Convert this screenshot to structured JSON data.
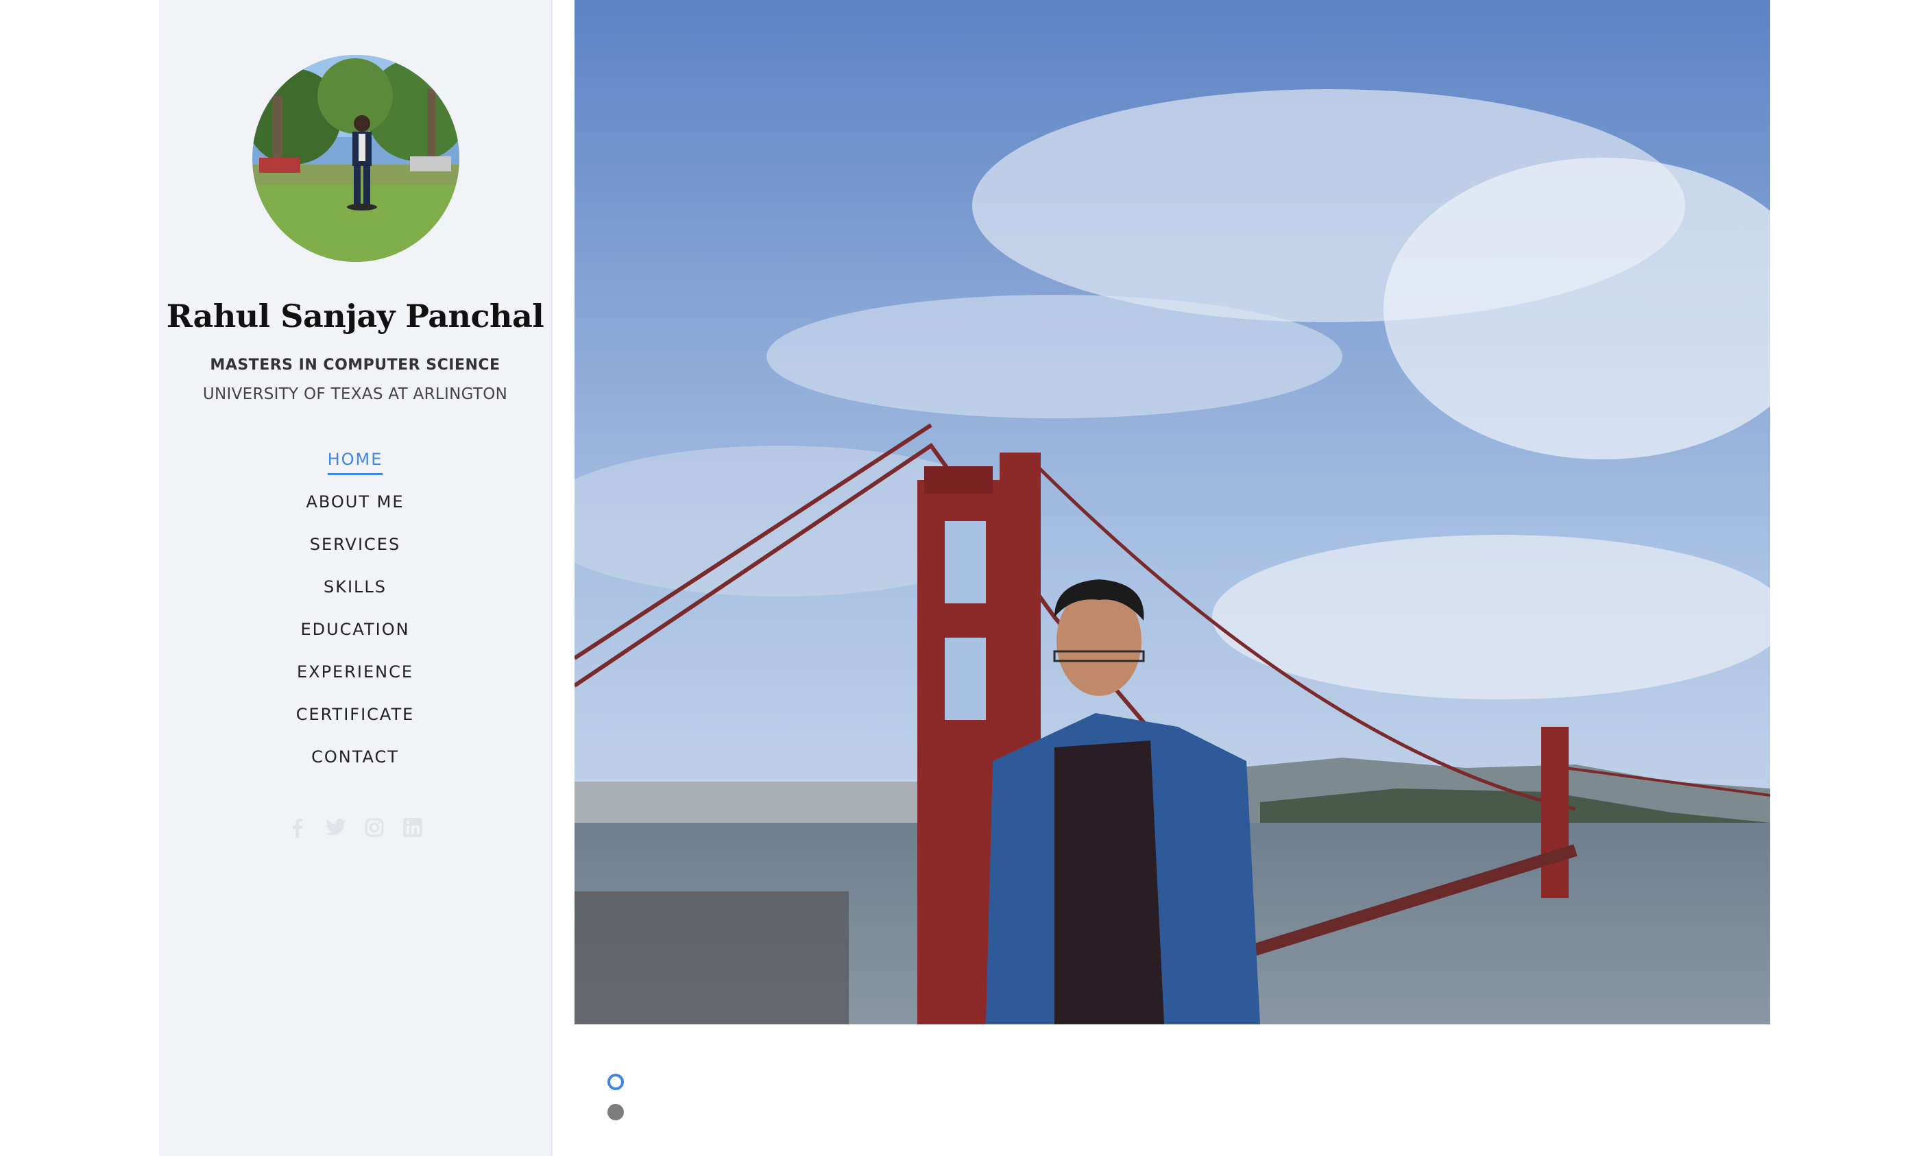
{
  "profile": {
    "name": "Rahul Sanjay Panchal",
    "degree": "MASTERS IN COMPUTER SCIENCE",
    "university": "UNIVERSITY OF TEXAS AT ARLINGTON"
  },
  "nav": {
    "items": [
      {
        "label": "HOME",
        "active": true
      },
      {
        "label": "ABOUT ME"
      },
      {
        "label": "SERVICES"
      },
      {
        "label": "SKILLS"
      },
      {
        "label": "EDUCATION"
      },
      {
        "label": "EXPERIENCE"
      },
      {
        "label": "CERTIFICATE"
      },
      {
        "label": "CONTACT"
      }
    ]
  },
  "social": [
    "facebook-icon",
    "twitter-icon",
    "instagram-icon",
    "linkedin-icon"
  ],
  "slider": {
    "slide_count": 2,
    "active_index": 0
  },
  "colors": {
    "accent": "#3f87e8",
    "sidebar_bg": "#f2f3f7",
    "inactive_dot": "#7d7d7d"
  }
}
